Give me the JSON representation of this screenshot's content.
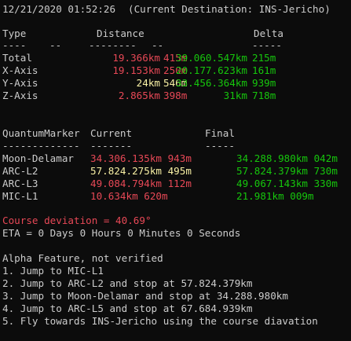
{
  "header": {
    "datetime": "12/21/2020 01:52:26",
    "destination_label": "(Current Destination: INS-Jericho)"
  },
  "axes_table": {
    "headers": {
      "type": "Type",
      "distance": "Distance",
      "delta": "Delta"
    },
    "separators": {
      "s1": "----",
      "s2": "--",
      "s3": "--------",
      "s4": "--",
      "s5": "-----"
    },
    "rows": [
      {
        "label": "Total",
        "dist_km": "19.366km",
        "dist_m": "415m",
        "delta_km": "39.060.547km",
        "delta_m": "215m"
      },
      {
        "label": "X-Axis",
        "dist_km": "19.153km",
        "dist_m": "250m",
        "delta_km": "20.177.623km",
        "delta_m": "161m"
      },
      {
        "label": "Y-Axis",
        "dist_km": "24km",
        "dist_m": "546m",
        "delta_km": "33.456.364km",
        "delta_m": "939m"
      },
      {
        "label": "Z-Axis",
        "dist_km": "2.865km",
        "dist_m": "398m",
        "delta_km": "31km",
        "delta_m": "718m"
      }
    ]
  },
  "markers_table": {
    "headers": {
      "marker": "QuantumMarker",
      "current": "Current",
      "final": "Final"
    },
    "separators": {
      "s1": "-------------",
      "s2": "-------",
      "s3": "-----"
    },
    "rows": [
      {
        "name": "Moon-Delamar",
        "current": "34.306.135km 943m",
        "final": "34.288.980km 042m"
      },
      {
        "name": "ARC-L2",
        "current": "57.824.275km 495m",
        "final": "57.824.379km 730m"
      },
      {
        "name": "ARC-L3",
        "current": "49.084.794km 112m",
        "final": "49.067.143km 330m"
      },
      {
        "name": "MIC-L1",
        "current": "10.634km 620m",
        "final": "21.981km 009m"
      }
    ]
  },
  "course": {
    "deviation_label": "Course deviation = 40.69°",
    "eta_label": "ETA = 0 Days 0 Hours 0 Minutes 0 Seconds"
  },
  "alpha": {
    "title": "Alpha Feature, not verified",
    "steps": [
      "1. Jump to MIC-L1",
      "2. Jump to ARC-L2 and stop at 57.824.379km",
      "3. Jump to Moon-Delamar and stop at 34.288.980km",
      "4. Jump to ARC-L5 and stop at 67.684.939km",
      "5. Fly towards INS-Jericho using the course diavation"
    ]
  },
  "colors": {
    "background": "#0c0c0c",
    "text": "#cccccc",
    "red": "#e74856",
    "green": "#16c60c",
    "yellow": "#f9f1a5"
  }
}
